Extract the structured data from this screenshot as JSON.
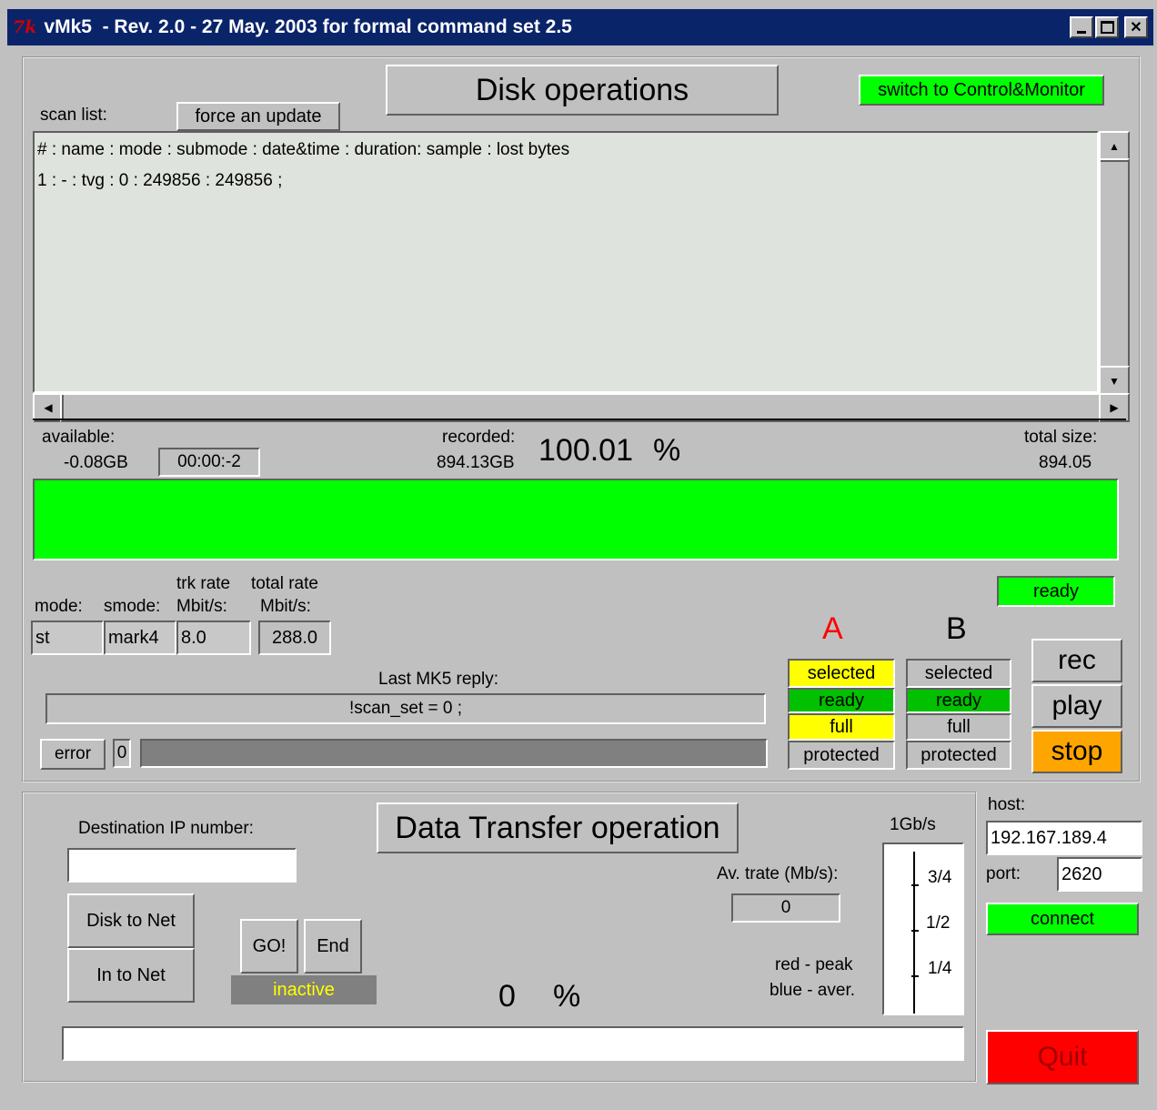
{
  "window": {
    "title": "vMk5  - Rev. 2.0 - 27 May. 2003 for formal command set 2.5"
  },
  "disk": {
    "heading": "Disk operations",
    "switch_label": "switch to Control&Monitor",
    "scan_list_label": "scan list:",
    "force_update_label": "force an update",
    "scan_lines": [
      "# : name : mode : submode : date&time : duration: sample : lost bytes",
      "1 : - : tvg : 0 : 249856 : 249856 ;"
    ],
    "available_label": "available:",
    "available_value": "-0.08GB",
    "time_value": "00:00:-2",
    "recorded_label": "recorded:",
    "recorded_value": "894.13GB",
    "percent_value": "100.01",
    "percent_sign": "%",
    "total_size_label": "total size:",
    "total_size_value": "894.05",
    "status": "ready",
    "mode_label": "mode:",
    "mode_value": "st",
    "smode_label": "smode:",
    "smode_value": "mark4",
    "trk_rate_label1": "trk rate",
    "trk_rate_label2": "Mbit/s:",
    "trk_rate_value": "8.0",
    "total_rate_label1": "total rate",
    "total_rate_label2": "Mbit/s:",
    "total_rate_value": "288.0",
    "last_reply_label": "Last MK5 reply:",
    "last_reply_value": "!scan_set = 0 ;",
    "error_label": "error",
    "error_count": "0",
    "bank_a": {
      "label": "A",
      "selected": "selected",
      "ready": "ready",
      "full": "full",
      "protected": "protected"
    },
    "bank_b": {
      "label": "B",
      "selected": "selected",
      "ready": "ready",
      "full": "full",
      "protected": "protected"
    },
    "rec_label": "rec",
    "play_label": "play",
    "stop_label": "stop"
  },
  "transfer": {
    "heading": "Data Transfer operation",
    "dest_ip_label": "Destination IP number:",
    "dest_ip_value": "",
    "disk_to_net": "Disk to Net",
    "in_to_net": "In to Net",
    "go_label": "GO!",
    "end_label": "End",
    "state": "inactive",
    "percent_value": "0",
    "percent_sign": "%",
    "av_trate_label": "Av. trate (Mb/s):",
    "av_trate_value": "0",
    "legend_red": "red - peak",
    "legend_blue": "blue - aver.",
    "gauge_top": "1Gb/s",
    "gauge_ticks": [
      "3/4",
      "1/2",
      "1/4"
    ]
  },
  "connection": {
    "host_label": "host:",
    "host_value": "192.167.189.4",
    "port_label": "port:",
    "port_value": "2620",
    "connect_label": "connect",
    "quit_label": "Quit"
  },
  "colors": {
    "green": "#00ff00",
    "yellow": "#ffff00",
    "orange": "#ffa500",
    "red": "#ff0000",
    "titlebar": "#0a246a"
  }
}
